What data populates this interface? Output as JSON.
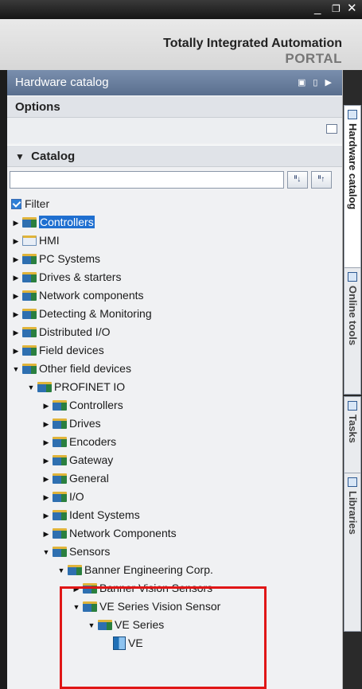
{
  "window": {
    "minimize_glyph": "_",
    "restore_glyph": "❐",
    "close_glyph": "✕"
  },
  "brand": {
    "line1": "Totally Integrated Automation",
    "line2": "PORTAL"
  },
  "panel": {
    "title": "Hardware catalog",
    "options_label": "Options",
    "catalog_label": "Catalog",
    "search": {
      "value": "",
      "placeholder": ""
    },
    "filter_label": "Filter",
    "filter_checked": true
  },
  "tree": [
    {
      "label": "Controllers",
      "expanded": false,
      "selected": true,
      "icon": "folder-icon"
    },
    {
      "label": "HMI",
      "expanded": false,
      "icon": "hmi-folder-icon"
    },
    {
      "label": "PC Systems",
      "expanded": false,
      "icon": "folder-icon"
    },
    {
      "label": "Drives & starters",
      "expanded": false,
      "icon": "folder-icon"
    },
    {
      "label": "Network components",
      "expanded": false,
      "icon": "folder-icon"
    },
    {
      "label": "Detecting & Monitoring",
      "expanded": false,
      "icon": "folder-icon"
    },
    {
      "label": "Distributed I/O",
      "expanded": false,
      "icon": "folder-icon"
    },
    {
      "label": "Field devices",
      "expanded": false,
      "icon": "folder-icon"
    },
    {
      "label": "Other field devices",
      "expanded": true,
      "icon": "folder-icon"
    },
    {
      "label": "PROFINET IO",
      "expanded": true,
      "icon": "folder-icon"
    },
    {
      "label": "Controllers",
      "expanded": false,
      "icon": "folder-icon"
    },
    {
      "label": "Drives",
      "expanded": false,
      "icon": "folder-icon"
    },
    {
      "label": "Encoders",
      "expanded": false,
      "icon": "folder-icon"
    },
    {
      "label": "Gateway",
      "expanded": false,
      "icon": "folder-icon"
    },
    {
      "label": "General",
      "expanded": false,
      "icon": "folder-icon"
    },
    {
      "label": "I/O",
      "expanded": false,
      "icon": "folder-icon"
    },
    {
      "label": "Ident Systems",
      "expanded": false,
      "icon": "folder-icon"
    },
    {
      "label": "Network Components",
      "expanded": false,
      "icon": "folder-icon"
    },
    {
      "label": "Sensors",
      "expanded": true,
      "icon": "folder-icon"
    },
    {
      "label": "Banner Engineering Corp.",
      "expanded": true,
      "icon": "folder-icon"
    },
    {
      "label": "Banner Vision Sensors",
      "expanded": false,
      "icon": "folder-icon"
    },
    {
      "label": "VE Series Vision Sensor",
      "expanded": true,
      "icon": "folder-icon"
    },
    {
      "label": "VE Series",
      "expanded": true,
      "icon": "folder-icon"
    },
    {
      "label": "VE",
      "icon": "device-icon"
    }
  ],
  "side_tabs": [
    {
      "label": "Hardware catalog",
      "active": true
    },
    {
      "label": "Online tools",
      "active": false
    },
    {
      "label": "Tasks",
      "active": false
    },
    {
      "label": "Libraries",
      "active": false
    }
  ]
}
